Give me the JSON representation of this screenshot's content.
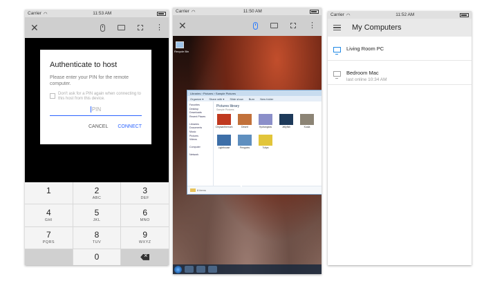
{
  "colors": {
    "accent": "#2962ff",
    "online_icon": "#1e88e5",
    "offline_icon": "#9e9e9e"
  },
  "auth_screen": {
    "status": {
      "carrier": "Carrier",
      "time": "11:53 AM"
    },
    "toolbar": {
      "close_icon": "close-icon",
      "icons": [
        "mouse-icon",
        "keyboard-icon",
        "fullscreen-icon",
        "more-vert-icon"
      ]
    },
    "dialog": {
      "title": "Authenticate to host",
      "prompt": "Please enter your PIN for the remote computer.",
      "checkbox_label": "Don't ask for a PIN again when connecting to this host from this device.",
      "pin_placeholder": "PIN",
      "cancel": "CANCEL",
      "connect": "CONNECT"
    },
    "keypad": [
      {
        "num": "1",
        "letters": ""
      },
      {
        "num": "2",
        "letters": "ABC"
      },
      {
        "num": "3",
        "letters": "DEF"
      },
      {
        "num": "4",
        "letters": "GHI"
      },
      {
        "num": "5",
        "letters": "JKL"
      },
      {
        "num": "6",
        "letters": "MNO"
      },
      {
        "num": "7",
        "letters": "PQRS"
      },
      {
        "num": "8",
        "letters": "TUV"
      },
      {
        "num": "9",
        "letters": "WXYZ"
      },
      {
        "num": "0",
        "letters": ""
      }
    ]
  },
  "remote_screen": {
    "status": {
      "carrier": "Carrier",
      "time": "11:50 AM"
    },
    "desktop_icon_label": "Recycle Bin",
    "explorer": {
      "breadcrumb": "Libraries › Pictures › Sample Pictures",
      "toolbar": [
        "Organize ▾",
        "Share with ▾",
        "Slide show",
        "Burn",
        "New folder"
      ],
      "sidebar": [
        "Favorites",
        "Desktop",
        "Downloads",
        "Recent Places",
        "",
        "Libraries",
        "Documents",
        "Music",
        "Pictures",
        "Videos",
        "",
        "Computer",
        "",
        "Network"
      ],
      "library_title": "Pictures library",
      "library_sub": "Sample Pictures",
      "thumbnails": [
        {
          "caption": "Chrysanthemum",
          "color": "#c0391f"
        },
        {
          "caption": "Desert",
          "color": "#c2713a"
        },
        {
          "caption": "Hydrangeas",
          "color": "#8b8fc9"
        },
        {
          "caption": "Jellyfish",
          "color": "#1e3a5a"
        },
        {
          "caption": "Koala",
          "color": "#8c8475"
        },
        {
          "caption": "Lighthouse",
          "color": "#3d6fa8"
        },
        {
          "caption": "Penguins",
          "color": "#5f8fbf"
        },
        {
          "caption": "Tulips",
          "color": "#e2c53a"
        }
      ],
      "status": "8 items"
    }
  },
  "computers_screen": {
    "status": {
      "carrier": "Carrier",
      "time": "11:52 AM"
    },
    "title": "My Computers",
    "hosts": [
      {
        "name": "Living Room PC",
        "sub": "",
        "online": true
      },
      {
        "name": "Bedroom Mac",
        "sub": "last online 10:34 AM",
        "online": false
      }
    ]
  }
}
